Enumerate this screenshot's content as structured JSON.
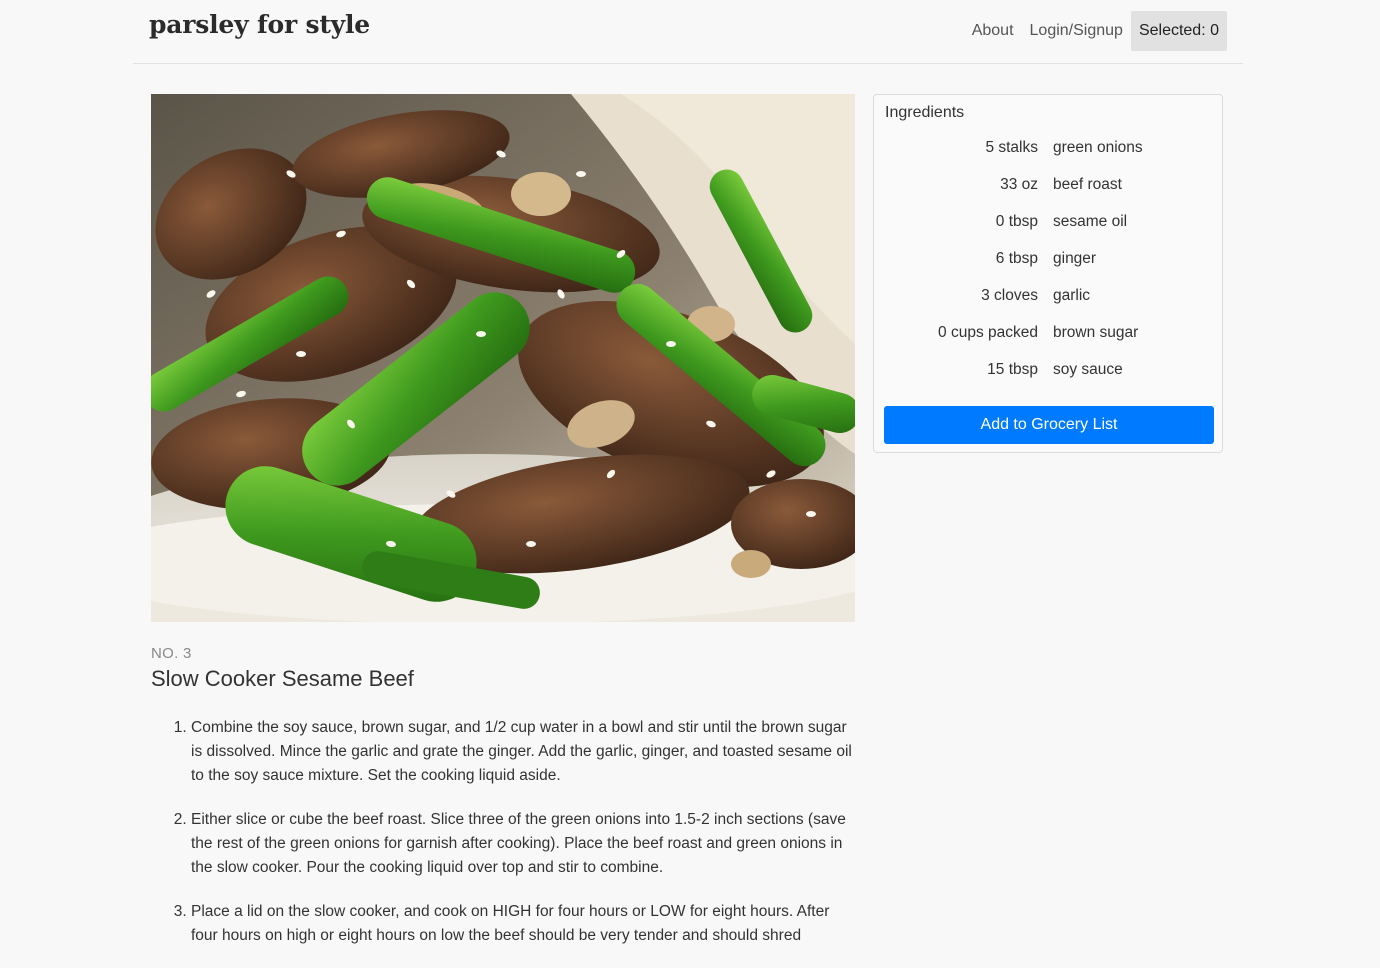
{
  "nav": {
    "brand": "parsley for style",
    "links": [
      "About",
      "Login/Signup"
    ],
    "selected": "Selected: 0"
  },
  "recipe": {
    "number": "NO. 3",
    "title": "Slow Cooker Sesame Beef",
    "image_alt": "sesame beef stir fry with snap peas over rice",
    "steps": [
      "Combine the soy sauce, brown sugar, and 1/2 cup water in a bowl and stir until the brown sugar is dissolved. Mince the garlic and grate the ginger. Add the garlic, ginger, and toasted sesame oil to the soy sauce mixture. Set the cooking liquid aside.",
      "Either slice or cube the beef roast. Slice three of the green onions into 1.5-2 inch sections (save the rest of the green onions for garnish after cooking). Place the beef roast and green onions in the slow cooker. Pour the cooking liquid over top and stir to combine.",
      "Place a lid on the slow cooker, and cook on HIGH for four hours or LOW for eight hours. After four hours on high or eight hours on low the beef should be very tender and should shred"
    ]
  },
  "ingredients": {
    "title": "Ingredients",
    "items": [
      {
        "qty": "5 stalks",
        "name": "green onions"
      },
      {
        "qty": "33 oz",
        "name": "beef roast"
      },
      {
        "qty": "0 tbsp",
        "name": "sesame oil"
      },
      {
        "qty": "6 tbsp",
        "name": "ginger"
      },
      {
        "qty": "3 cloves",
        "name": "garlic"
      },
      {
        "qty": "0 cups packed",
        "name": "brown sugar"
      },
      {
        "qty": "15 tbsp",
        "name": "soy sauce"
      }
    ],
    "button": "Add to Grocery List"
  },
  "colors": {
    "accent": "#007bff",
    "background": "#f8f8f8",
    "selected_bg": "#e1e1e1"
  }
}
